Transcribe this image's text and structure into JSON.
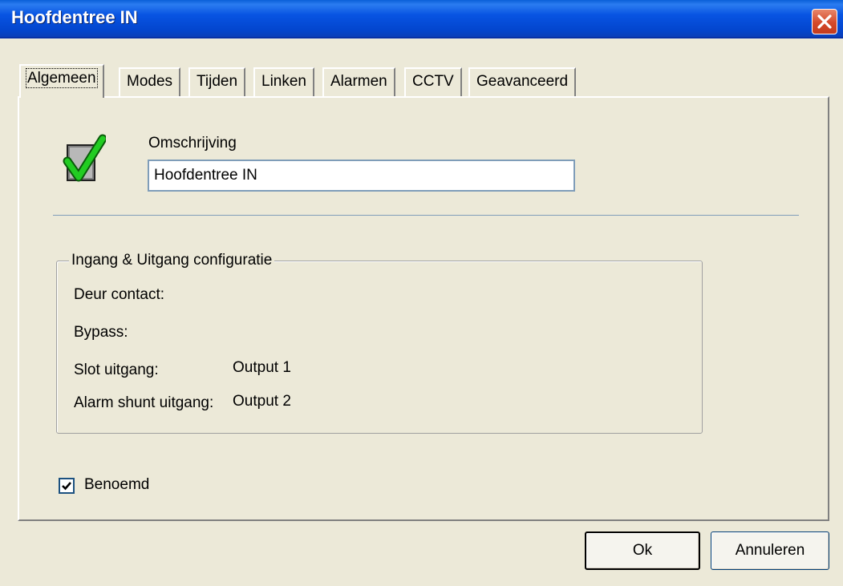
{
  "window": {
    "title": "Hoofdentree IN"
  },
  "tabs": [
    {
      "label": "Algemeen",
      "active": true
    },
    {
      "label": "Modes"
    },
    {
      "label": "Tijden"
    },
    {
      "label": "Linken"
    },
    {
      "label": "Alarmen"
    },
    {
      "label": "CCTV"
    },
    {
      "label": "Geavanceerd"
    }
  ],
  "general": {
    "description_label": "Omschrijving",
    "description_value": "Hoofdentree IN"
  },
  "io_config": {
    "legend": "Ingang & Uitgang configuratie",
    "fields": [
      {
        "label": "Deur contact:",
        "value": ""
      },
      {
        "label": "Bypass:",
        "value": ""
      },
      {
        "label": "Slot uitgang:",
        "value": "Output 1"
      },
      {
        "label": "Alarm shunt uitgang:",
        "value": "Output 2"
      }
    ]
  },
  "named_checkbox": {
    "label": "Benoemd",
    "checked": true
  },
  "buttons": {
    "ok": "Ok",
    "cancel": "Annuleren"
  },
  "colors": {
    "titlebar": "#0054e3",
    "dialog_bg": "#ece9d8",
    "check_green": "#22cc22"
  }
}
